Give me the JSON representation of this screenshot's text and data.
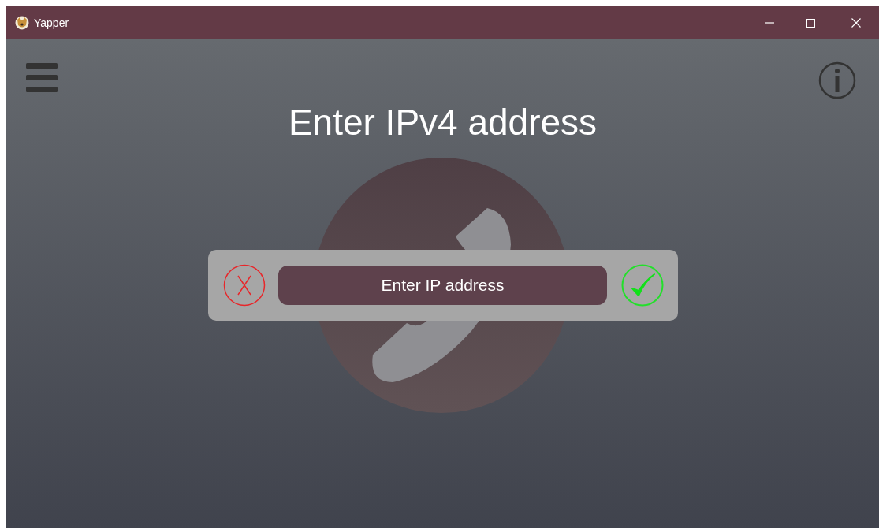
{
  "window": {
    "title": "Yapper"
  },
  "heading": "Enter IPv4 address",
  "address_field": {
    "placeholder": "Enter IP address"
  }
}
